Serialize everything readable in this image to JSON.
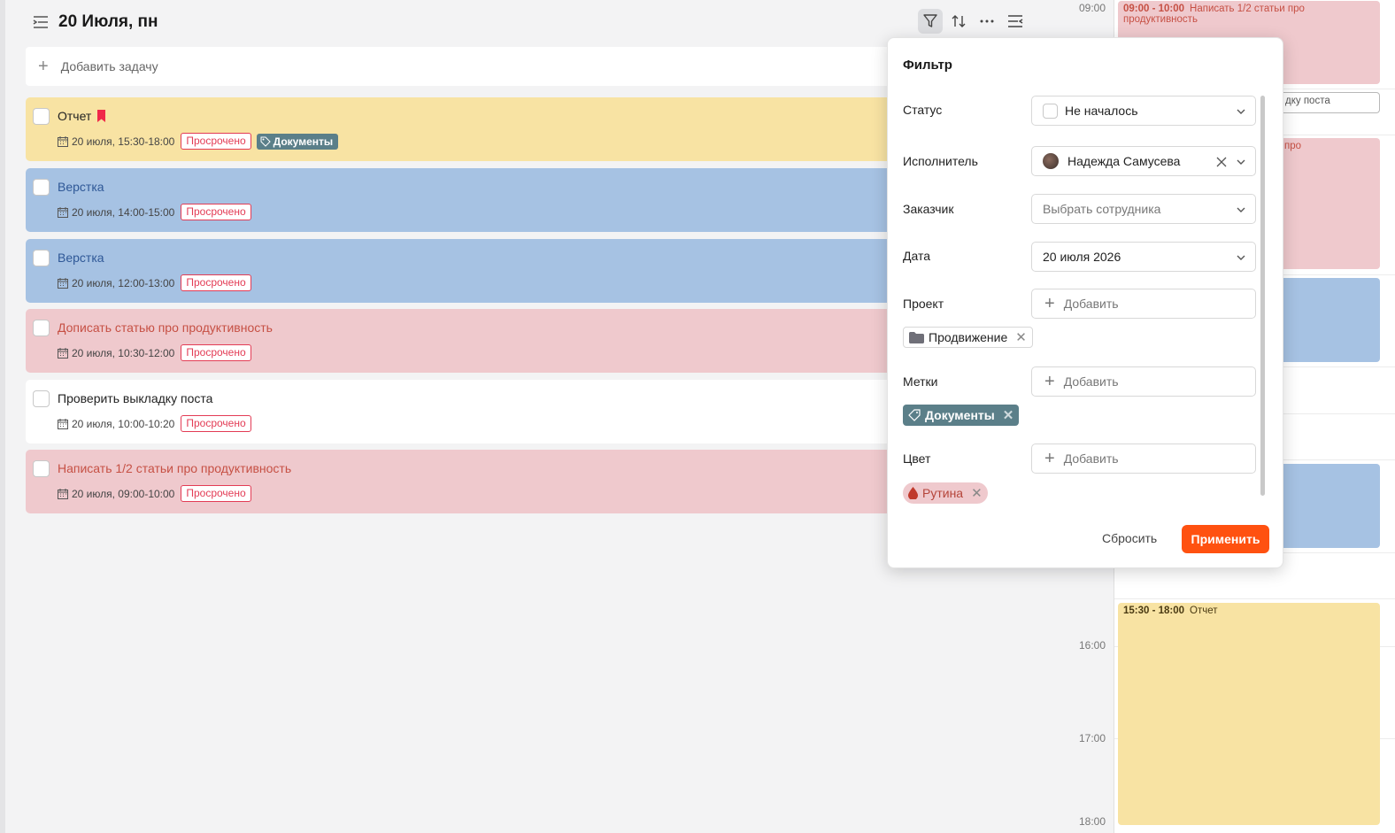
{
  "header": {
    "title": "20 Июля, пн"
  },
  "add_task": {
    "label": "Добавить задачу"
  },
  "tasks": [
    {
      "name": "Отчет",
      "date": "20 июля, 15:30-18:00",
      "badge": "Просрочено",
      "tag": "Документы"
    },
    {
      "name": "Верстка",
      "date": "20 июля, 14:00-15:00",
      "badge": "Просрочено"
    },
    {
      "name": "Верстка",
      "date": "20 июля, 12:00-13:00",
      "badge": "Просрочено"
    },
    {
      "name": "Дописать статью про продуктивность",
      "date": "20 июля, 10:30-12:00",
      "badge": "Просрочено"
    },
    {
      "name": "Проверить выкладку поста",
      "date": "20 июля, 10:00-10:20",
      "badge": "Просрочено"
    },
    {
      "name": "Написать 1/2 статьи про продуктивность",
      "date": "20 июля, 09:00-10:00",
      "badge": "Просрочено"
    }
  ],
  "calendar": {
    "hours": [
      "09:00",
      "16:00",
      "17:00",
      "18:00"
    ],
    "events": [
      {
        "time": "09:00 - 10:00",
        "title": "Написать 1/2 статьи про продуктивность"
      },
      {
        "title": "дку поста"
      },
      {
        "title": "про"
      },
      {
        "time": "15:30 - 18:00",
        "title": "Отчет"
      }
    ]
  },
  "filter": {
    "title": "Фильтр",
    "status": {
      "label": "Статус",
      "value": "Не началось"
    },
    "assignee": {
      "label": "Исполнитель",
      "value": "Надежда Самусева"
    },
    "customer": {
      "label": "Заказчик",
      "placeholder": "Выбрать сотрудника"
    },
    "date": {
      "label": "Дата",
      "value": "20 июля 2026"
    },
    "project": {
      "label": "Проект",
      "add": "Добавить",
      "chip": "Продвижение"
    },
    "tags": {
      "label": "Метки",
      "add": "Добавить",
      "chip": "Документы"
    },
    "color": {
      "label": "Цвет",
      "add": "Добавить",
      "chip": "Рутина"
    },
    "reset": "Сбросить",
    "apply": "Применить"
  }
}
